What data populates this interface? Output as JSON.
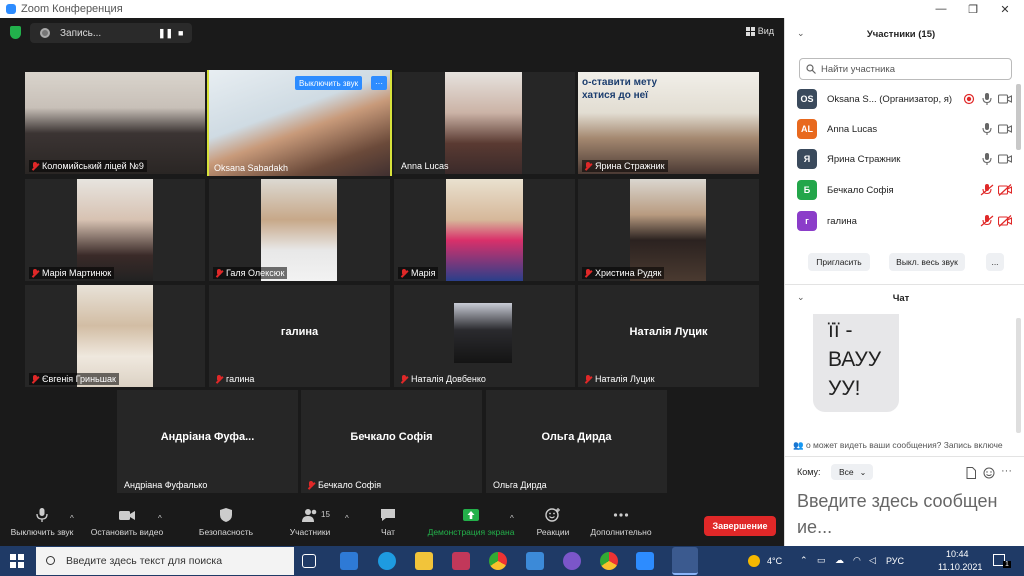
{
  "window": {
    "title": "Zoom Конференция",
    "minimize": "—",
    "maximize": "❐",
    "close": "✕"
  },
  "topbar": {
    "recording_label": "Запись...",
    "pause": "❚❚",
    "stop": "■",
    "view_label": "Вид"
  },
  "tiles": {
    "t1": "Коломийський ліцей №9",
    "t2": "Oksana Sabadakh",
    "t2_unmute": "Выключить звук",
    "t2_more": "···",
    "t3": "Anna Lucas",
    "t4": "Ярина Стражник",
    "t4_poster": "о-ставити мету\nхатися до неї",
    "t5": "Марія Мартинюк",
    "t6": "Галя Олексюк",
    "t7": "Марія",
    "t8": "Христина Рудяк",
    "t9": "Євгенія Гриньшак",
    "t10": "галина",
    "t10_big": "галина",
    "t11": "Наталія Довбенко",
    "t12": "Наталія Луцик",
    "t12_big": "Наталія Луцик",
    "t13": "Андріана Фуфалько",
    "t13_big": "Андріана Фуфа...",
    "t14": "Бечкало Софія",
    "t14_big": "Бечкало Софія",
    "t15": "Ольга Дирда",
    "t15_big": "Ольга Дирда"
  },
  "toolbar": {
    "mute": "Выключить звук",
    "video": "Остановить видео",
    "security": "Безопасность",
    "participants": "Участники",
    "participants_count": "15",
    "chat": "Чат",
    "share": "Демонстрация экрана",
    "reactions": "Реакции",
    "more": "Дополнительно",
    "end": "Завершение",
    "caret": "^"
  },
  "panel": {
    "participants_title": "Участники (15)",
    "search_placeholder": "Найти участника",
    "participants": [
      {
        "initials": "OS",
        "name": "Oksana S... (Организатор, я)",
        "color": "#3a4a5c"
      },
      {
        "initials": "AL",
        "name": "Anna Lucas",
        "color": "#e8691e"
      },
      {
        "initials": "Я",
        "name": "Ярина Стражник",
        "color": "#3a4a5c"
      },
      {
        "initials": "Б",
        "name": "Бечкало Софія",
        "color": "#23a64a"
      },
      {
        "initials": "г",
        "name": "галина",
        "color": "#8b3dc9"
      }
    ],
    "invite": "Пригласить",
    "mute_all": "Выкл. весь звук",
    "more": "...",
    "chat_title": "Чат",
    "chat_message": "її -\nВАУУ\nУУ!",
    "chat_note": "о может видеть ваши сообщения? Запись включе",
    "to_label": "Кому:",
    "to_value": "Все",
    "input_placeholder": "Введите здесь сообщен\nие..."
  },
  "taskbar": {
    "search": "Введите здесь текст для поиска",
    "weather": "4°C",
    "lang": "РУС",
    "time": "10:44",
    "date": "11.10.2021",
    "notif_count": "1"
  },
  "colors": {
    "accent": "#2d8cff",
    "end_red": "#e02828",
    "active_border": "#d8e23a",
    "share_green": "#23b04a"
  }
}
